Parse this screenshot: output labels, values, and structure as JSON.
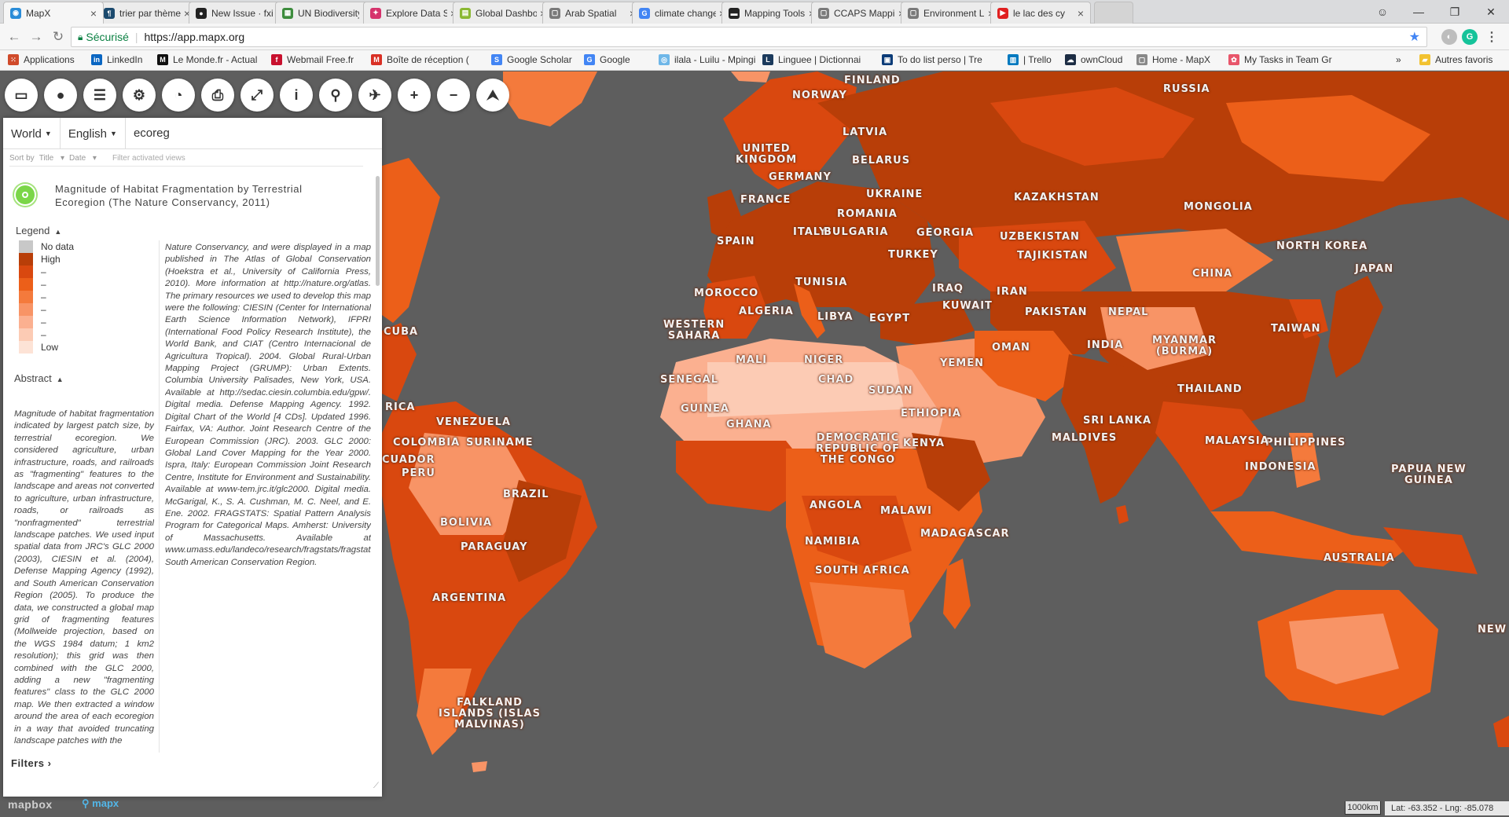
{
  "browser": {
    "tabs": [
      {
        "label": "MapX",
        "color": "#2a8cd8",
        "glyph": "◉"
      },
      {
        "label": "trier par thème",
        "color": "#1b4a6e",
        "glyph": "¶"
      },
      {
        "label": "New Issue · fxi/",
        "color": "#222222",
        "glyph": "●"
      },
      {
        "label": "UN Biodiversity",
        "color": "#3d8c3d",
        "glyph": "▦"
      },
      {
        "label": "Explore Data S",
        "color": "#d6336c",
        "glyph": "✦"
      },
      {
        "label": "Global Dashbo",
        "color": "#8bb833",
        "glyph": "▤"
      },
      {
        "label": "Arab Spatial",
        "color": "#7a7a7a",
        "glyph": "▢"
      },
      {
        "label": "climate change",
        "color": "#4285f4",
        "glyph": "G"
      },
      {
        "label": "Mapping Tools",
        "color": "#222222",
        "glyph": "▬"
      },
      {
        "label": "CCAPS Mappin",
        "color": "#7a7a7a",
        "glyph": "▢"
      },
      {
        "label": "Environment Li",
        "color": "#7a7a7a",
        "glyph": "▢"
      },
      {
        "label": "le lac des cy",
        "color": "#e02020",
        "glyph": "▶"
      }
    ],
    "window_controls": [
      "—",
      "❐",
      "✕"
    ],
    "address": {
      "secure_label": "Sécurisé",
      "url": "https://app.mapx.org"
    },
    "bookmarks": [
      {
        "label": "Applications",
        "color": "#d04a2a",
        "glyph": "⁙"
      },
      {
        "label": "LinkedIn",
        "color": "#0a66c2",
        "glyph": "in"
      },
      {
        "label": "Le Monde.fr - Actual",
        "color": "#111111",
        "glyph": "M"
      },
      {
        "label": "Webmail Free.fr",
        "color": "#c8102e",
        "glyph": "f"
      },
      {
        "label": "Boîte de réception (",
        "color": "#d93025",
        "glyph": "M"
      },
      {
        "label": "Google Scholar",
        "color": "#4285f4",
        "glyph": "S"
      },
      {
        "label": "Google",
        "color": "#4285f4",
        "glyph": "G"
      },
      {
        "label": "ilala - Luilu - Mpingi",
        "color": "#6fb7e8",
        "glyph": "◎"
      },
      {
        "label": "Linguee | Dictionnai",
        "color": "#1b3a5c",
        "glyph": "L"
      },
      {
        "label": "To do list perso | Tre",
        "color": "#0c3c78",
        "glyph": "▣"
      },
      {
        "label": "| Trello",
        "color": "#0079bf",
        "glyph": "▥"
      },
      {
        "label": "ownCloud",
        "color": "#1d2d44",
        "glyph": "☁"
      },
      {
        "label": "Home - MapX",
        "color": "#888888",
        "glyph": "▢"
      },
      {
        "label": "My Tasks in Team Gr",
        "color": "#e8566b",
        "glyph": "✿"
      },
      {
        "label": "»",
        "color": "",
        "glyph": ""
      },
      {
        "label": "Autres favoris",
        "color": "#f2c230",
        "glyph": "▰"
      }
    ]
  },
  "toolbar": {
    "buttons": [
      {
        "name": "display-icon",
        "glyph": "▭"
      },
      {
        "name": "user-icon",
        "glyph": "●"
      },
      {
        "name": "list-icon",
        "glyph": "☰"
      },
      {
        "name": "tools-icon",
        "glyph": "⚙"
      },
      {
        "name": "chart-icon",
        "glyph": "◔"
      },
      {
        "name": "print-icon",
        "glyph": "⎙"
      },
      {
        "name": "fullscreen-icon",
        "glyph": "⤢"
      },
      {
        "name": "info-icon",
        "glyph": "i"
      },
      {
        "name": "pin-icon",
        "glyph": "⚲"
      },
      {
        "name": "geolocate-icon",
        "glyph": "✈"
      },
      {
        "name": "zoom-in-icon",
        "glyph": "+"
      },
      {
        "name": "zoom-out-icon",
        "glyph": "−"
      },
      {
        "name": "north-arrow-icon",
        "glyph": "⮝"
      }
    ]
  },
  "panel": {
    "region": "World",
    "language": "English",
    "search_value": "ecoreg",
    "sort_label": "Sort by",
    "sort_title": "Title",
    "sort_date": "Date",
    "filter_placeholder": "Filter activated views",
    "view": {
      "title": "Magnitude of Habitat Fragmentation by Terrestrial Ecoregion (The Nature Conservancy, 2011)",
      "legend_header": "Legend",
      "legend": [
        {
          "label": "No data",
          "color": "#c8c8c8"
        },
        {
          "label": "High",
          "color": "#b83e08"
        },
        {
          "label": "–",
          "color": "#d9480f"
        },
        {
          "label": "–",
          "color": "#ec5f19"
        },
        {
          "label": "–",
          "color": "#f47a3c"
        },
        {
          "label": "–",
          "color": "#f89466"
        },
        {
          "label": "–",
          "color": "#fbb090"
        },
        {
          "label": "–",
          "color": "#fccbb4"
        },
        {
          "label": "Low",
          "color": "#fde3d6"
        }
      ],
      "abstract_header": "Abstract",
      "abstract_left": "Magnitude of habitat fragmentation indicated by largest patch size, by terrestrial ecoregion. We considered agriculture, urban infrastructure, roads, and railroads as \"fragmenting\" features to the landscape and areas not converted to agriculture, urban infrastructure, roads, or railroads as \"nonfragmented\" terrestrial landscape patches. We used input spatial data from JRC's GLC 2000 (2003), CIESIN et al. (2004), Defense Mapping Agency (1992), and South American Conservation Region (2005). To produce the data, we constructed a global map grid of fragmenting features (Mollweide projection, based on the WGS 1984 datum; 1 km2 resolution); this grid was then combined with the GLC 2000, adding a new \"fragmenting features\" class to the GLC 2000 map. We then extracted a window around the area of each ecoregion in a way that avoided truncating landscape patches with the",
      "abstract_right": "Nature Conservancy, and were displayed in a map published in The Atlas of Global Conservation (Hoekstra et al., University of California Press, 2010). More information at http://nature.org/atlas. The primary resources we used to develop this map were the following: CIESIN (Center for International Earth Science Information Network), IFPRI (International Food Policy Research Institute), the World Bank, and CIAT (Centro Internacional de Agricultura Tropical). 2004. Global Rural-Urban Mapping Project (GRUMP): Urban Extents. Columbia University Palisades, New York, USA. Available at http://sedac.ciesin.columbia.edu/gpw/. Digital media. Defense Mapping Agency. 1992. Digital Chart of the World [4 CDs]. Updated 1996. Fairfax, VA: Author. Joint Research Centre of the European Commission (JRC). 2003. GLC 2000: Global Land Cover Mapping for the Year 2000. Ispra, Italy: European Commission Joint Research Centre, Institute for Environment and Sustainability. Available at www-tem.jrc.it/glc2000. Digital media. McGarigal, K., S. A. Cushman, M. C. Neel, and E. Ene. 2002. FRAGSTATS: Spatial Pattern Analysis Program for Categorical Maps. Amherst: University of Massachusetts. Available at www.umass.edu/landeco/research/fragstats/fragstats.html. South American Conservation Region."
    },
    "filters_label": "Filters ›"
  },
  "map": {
    "labels": [
      "FINLAND",
      "NORWAY",
      "RUSSIA",
      "LATVIA",
      "UNITED KINGDOM",
      "BELARUS",
      "GERMANY",
      "UKRAINE",
      "FRANCE",
      "KAZAKHSTAN",
      "MONGOLIA",
      "ROMANIA",
      "SPAIN",
      "ITALY",
      "BULGARIA",
      "GEORGIA",
      "UZBEKISTAN",
      "TURKEY",
      "TAJIKISTAN",
      "NORTH KOREA",
      "JAPAN",
      "CHINA",
      "MOROCCO",
      "TUNISIA",
      "IRAQ",
      "IRAN",
      "KUWAIT",
      "ALGERIA",
      "LIBYA",
      "EGYPT",
      "PAKISTAN",
      "NEPAL",
      "WESTERN SAHARA",
      "CUBA",
      "OMAN",
      "INDIA",
      "MYANMAR (BURMA)",
      "TAIWAN",
      "MALI",
      "NIGER",
      "YEMEN",
      "SENEGAL",
      "CHAD",
      "SUDAN",
      "THAILAND",
      "PHILIPPINES",
      "GUINEA",
      "GHANA",
      "ETHIOPIA",
      "SRI LANKA",
      "VENEZUELA",
      "MALDIVES",
      "MALAYSIA",
      "COLOMBIA",
      "SURINAME",
      "DEMOCRATIC REPUBLIC OF THE CONGO",
      "KENYA",
      "CUADOR",
      "INDONESIA",
      "PAPUA NEW GUINEA",
      "PERU",
      "BRAZIL",
      "ANGOLA",
      "MALAWI",
      "BOLIVIA",
      "MADAGASCAR",
      "NAMIBIA",
      "PARAGUAY",
      "AUSTRALIA",
      "SOUTH AFRICA",
      "ARGENTINA",
      "NEW",
      "FALKLAND ISLANDS (ISLAS MALVINAS)",
      "RICA"
    ],
    "attribution": "mapbox",
    "brand": "mapx",
    "scale": "1000km",
    "coords": "Lat: -63.352 - Lng: -85.078"
  }
}
